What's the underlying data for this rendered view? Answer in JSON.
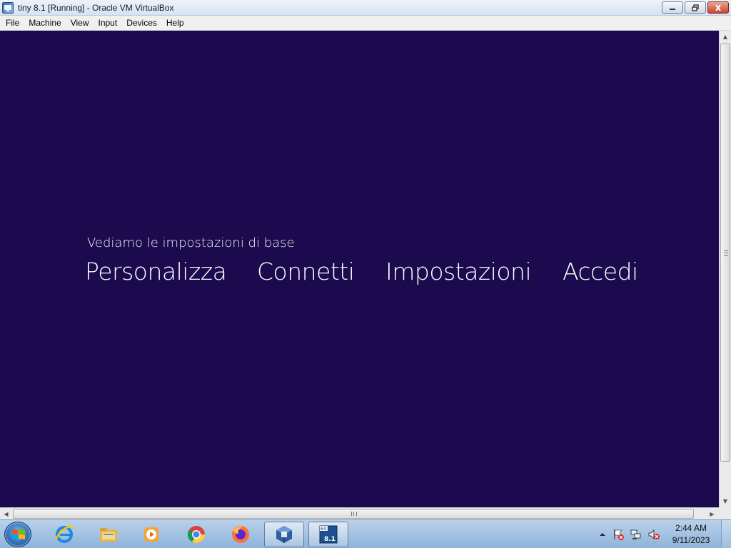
{
  "window": {
    "title": "tiny 8.1 [Running] - Oracle VM VirtualBox",
    "buttons": [
      "minimize",
      "maximize",
      "close"
    ]
  },
  "menu": {
    "items": [
      "File",
      "Machine",
      "View",
      "Input",
      "Devices",
      "Help"
    ]
  },
  "vm": {
    "background_color": "#1b0a4e",
    "heading": "Vediamo le impostazioni di base",
    "steps": [
      "Personalizza",
      "Connetti",
      "Impostazioni",
      "Accedi"
    ]
  },
  "taskbar": {
    "pinned": [
      {
        "name": "internet-explorer-icon"
      },
      {
        "name": "file-explorer-icon"
      },
      {
        "name": "media-player-icon"
      },
      {
        "name": "chrome-icon"
      },
      {
        "name": "firefox-icon"
      },
      {
        "name": "virtualbox-icon"
      },
      {
        "name": "vm-window-icon",
        "badge_top": "64",
        "badge": "8.1"
      }
    ],
    "tray": {
      "time": "2:44 AM",
      "date": "9/11/2023"
    }
  }
}
